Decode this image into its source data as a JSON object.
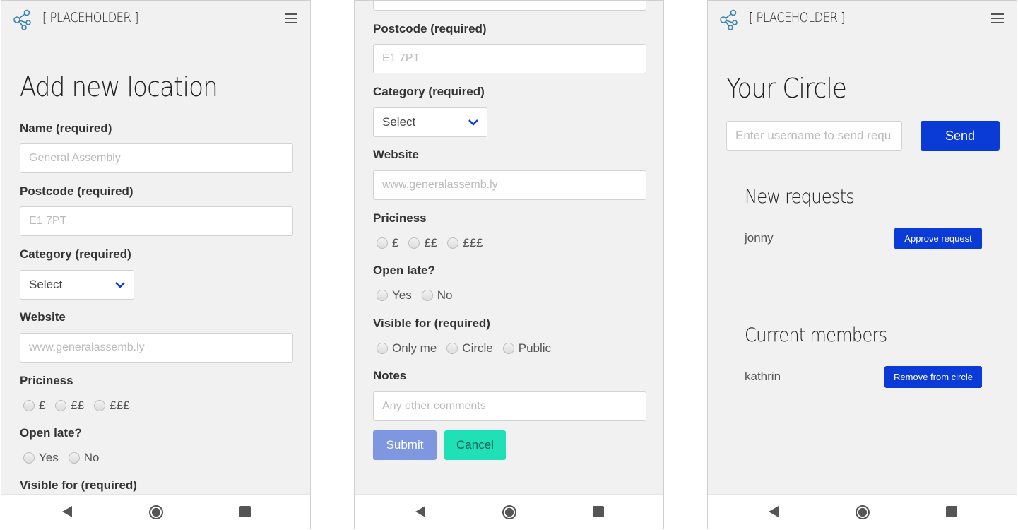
{
  "screen1": {
    "brand": "[ PLACEHOLDER ]",
    "title": "Add new location",
    "name_label": "Name (required)",
    "name_placeholder": "General Assembly",
    "postcode_label": "Postcode (required)",
    "postcode_placeholder": "E1 7PT",
    "category_label": "Category (required)",
    "category_value": "Select",
    "website_label": "Website",
    "website_placeholder": "www.generalassemb.ly",
    "priciness_label": "Priciness",
    "priciness_options": [
      "£",
      "££",
      "£££"
    ],
    "open_late_label": "Open late?",
    "open_late_options": [
      "Yes",
      "No"
    ],
    "visible_label": "Visible for (required)"
  },
  "screen2": {
    "postcode_label": "Postcode (required)",
    "postcode_placeholder": "E1 7PT",
    "category_label": "Category (required)",
    "category_value": "Select",
    "website_label": "Website",
    "website_placeholder": "www.generalassemb.ly",
    "priciness_label": "Priciness",
    "priciness_options": [
      "£",
      "££",
      "£££"
    ],
    "open_late_label": "Open late?",
    "open_late_options": [
      "Yes",
      "No"
    ],
    "visible_label": "Visible for (required)",
    "visible_options": [
      "Only me",
      "Circle",
      "Public"
    ],
    "notes_label": "Notes",
    "notes_placeholder": "Any other comments",
    "submit_label": "Submit",
    "cancel_label": "Cancel"
  },
  "screen3": {
    "brand": "[ PLACEHOLDER ]",
    "title": "Your Circle",
    "username_placeholder": "Enter username to send requ",
    "send_label": "Send",
    "new_requests_heading": "New requests",
    "requests": [
      {
        "user": "jonny",
        "action": "Approve request"
      }
    ],
    "members_heading": "Current members",
    "members": [
      {
        "user": "kathrin",
        "action": "Remove from circle"
      }
    ]
  },
  "colors": {
    "primary": "#0a3bd6",
    "submit": "#7f97e0",
    "cancel": "#1fe0b6",
    "logo": "#3a80b6"
  },
  "icons": {
    "logo": "share-network-icon",
    "menu": "hamburger-menu-icon",
    "chevron": "chevron-down-icon",
    "nav_back": "back-triangle-icon",
    "nav_home": "home-circle-icon",
    "nav_recent": "recent-apps-square-icon"
  }
}
